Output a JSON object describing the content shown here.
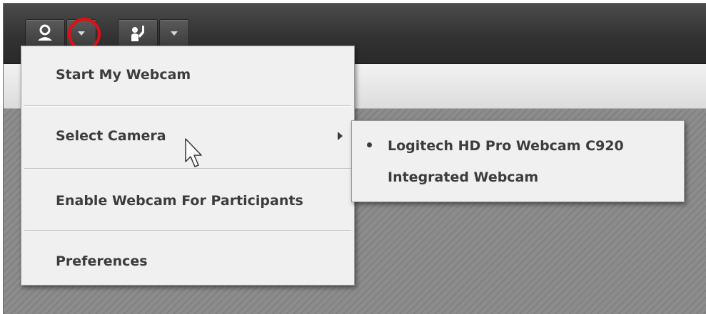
{
  "toolbar": {
    "webcam_button_icon": "webcam-user-icon",
    "webcam_dropdown_icon": "chevron-down-icon",
    "raise_hand_button_icon": "raise-hand-icon",
    "raise_hand_dropdown_icon": "chevron-down-icon",
    "highlight_color": "#e10e14"
  },
  "menu": {
    "items": [
      {
        "label": "Start My Webcam"
      },
      {
        "label": "Select Camera",
        "has_submenu": true
      },
      {
        "label": "Enable Webcam For Participants"
      },
      {
        "label": "Preferences"
      }
    ]
  },
  "submenu": {
    "items": [
      {
        "label": "Logitech HD Pro Webcam C920",
        "selected": true
      },
      {
        "label": "Integrated Webcam",
        "selected": false
      }
    ]
  },
  "cursor": {
    "icon": "mouse-pointer-icon"
  }
}
